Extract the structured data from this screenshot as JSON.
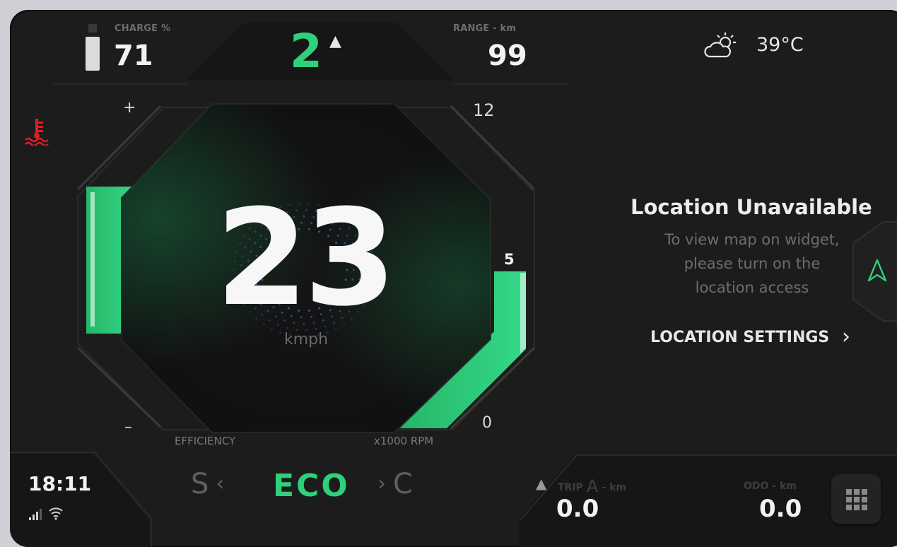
{
  "top": {
    "charge_label": "CHARGE %",
    "charge_value": "71",
    "gear_value": "2",
    "gear_arrow": "▲",
    "range_label": "RANGE - km",
    "range_value": "99",
    "temperature": "39°C",
    "weather_icon": "partly-cloudy-day-icon"
  },
  "gauge": {
    "speed": "23",
    "unit": "kmph",
    "efficiency_plus": "+",
    "efficiency_minus": "–",
    "efficiency_label": "EFFICIENCY",
    "rpm_max": "12",
    "rpm_min": "0",
    "rpm_current": "5",
    "rpm_label": "x1000 RPM",
    "rpm_fraction": 0.4167,
    "efficiency_fraction": 0.72
  },
  "location": {
    "title": "Location Unavailable",
    "line1": "To view map on widget,",
    "line2": "please turn on the",
    "line3": "location access",
    "settings_label": "LOCATION SETTINGS",
    "settings_chevron": "›"
  },
  "bottom": {
    "time": "18:11",
    "mode_prev": "S",
    "mode_prev_chevron": "‹",
    "mode_current": "ECO",
    "mode_next_chevron": "›",
    "mode_next": "C",
    "trip_arrow": "▲",
    "trip_label": "TRIP",
    "trip_letter": "A",
    "trip_unit": "- km",
    "trip_value": "0.0",
    "odo_label": "ODO - km",
    "odo_value": "0.0"
  },
  "colors": {
    "accent": "#2fd07a",
    "warning": "#e11d1d",
    "background": "#1c1c1d"
  }
}
